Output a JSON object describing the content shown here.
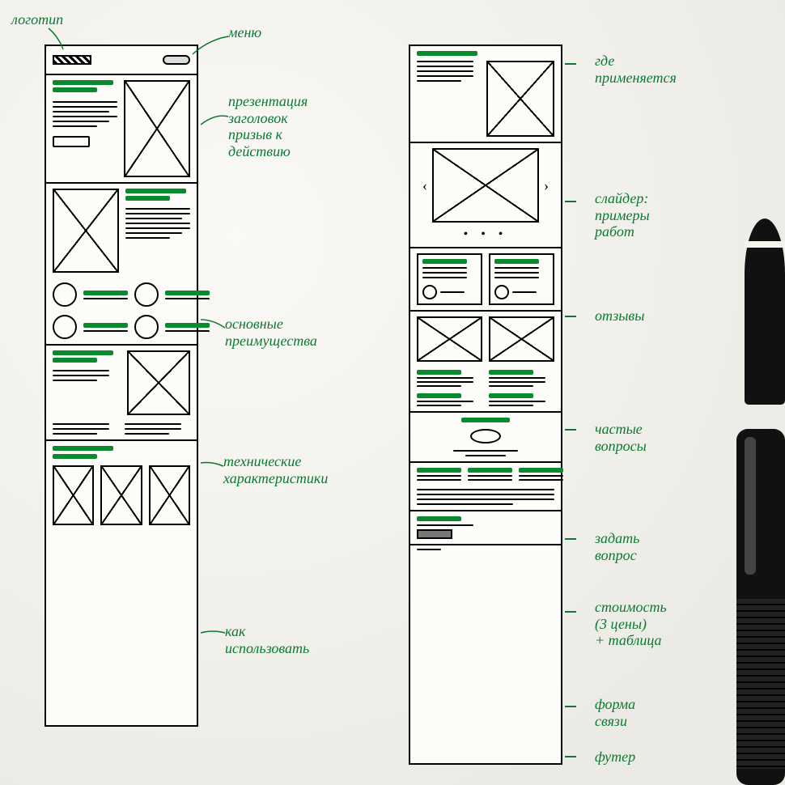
{
  "annotations": {
    "logo": "логотип",
    "menu": "меню",
    "hero": "презентация\nзаголовок\nпризыв к\nдействию",
    "benefits": "основные\nпреимущества",
    "specs": "технические\nхарактеристики",
    "howto": "как\nиспользовать",
    "usedwhere": "где\nприменяется",
    "slider": "слайдер:\nпримеры\nработ",
    "reviews": "отзывы",
    "faq": "частые\nвопросы",
    "ask": "задать\nвопрос",
    "pricing": "стоимость\n(3 цены)\n+ таблица",
    "form": "форма\nсвязи",
    "footer": "футер"
  }
}
